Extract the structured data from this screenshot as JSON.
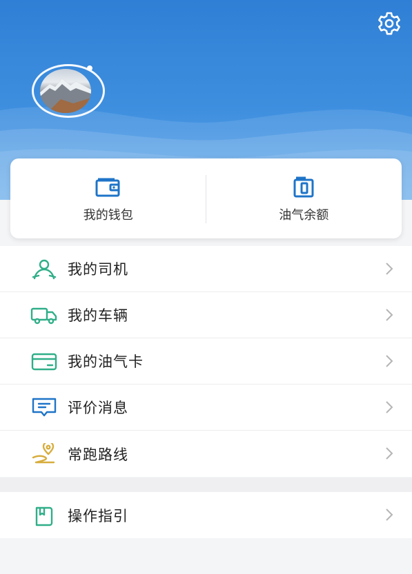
{
  "header": {
    "settings_icon": "gear-icon",
    "avatar_icon": "mountain-photo-avatar"
  },
  "wallet": [
    {
      "label": "我的钱包",
      "icon": "wallet-icon"
    },
    {
      "label": "油气余额",
      "icon": "balance-card-icon"
    }
  ],
  "menu": [
    {
      "label": "我的司机",
      "icon": "driver-icon"
    },
    {
      "label": "我的车辆",
      "icon": "truck-icon"
    },
    {
      "label": "我的油气卡",
      "icon": "card-icon"
    },
    {
      "label": "评价消息",
      "icon": "message-icon"
    },
    {
      "label": "常跑路线",
      "icon": "route-icon"
    }
  ],
  "menu2": [
    {
      "label": "操作指引",
      "icon": "guide-book-icon"
    }
  ],
  "colors": {
    "header_blue": "#2f7fd6",
    "green_icon": "#2fae88",
    "blue_icon": "#1e74c8",
    "gold_icon": "#d7ad3d"
  }
}
